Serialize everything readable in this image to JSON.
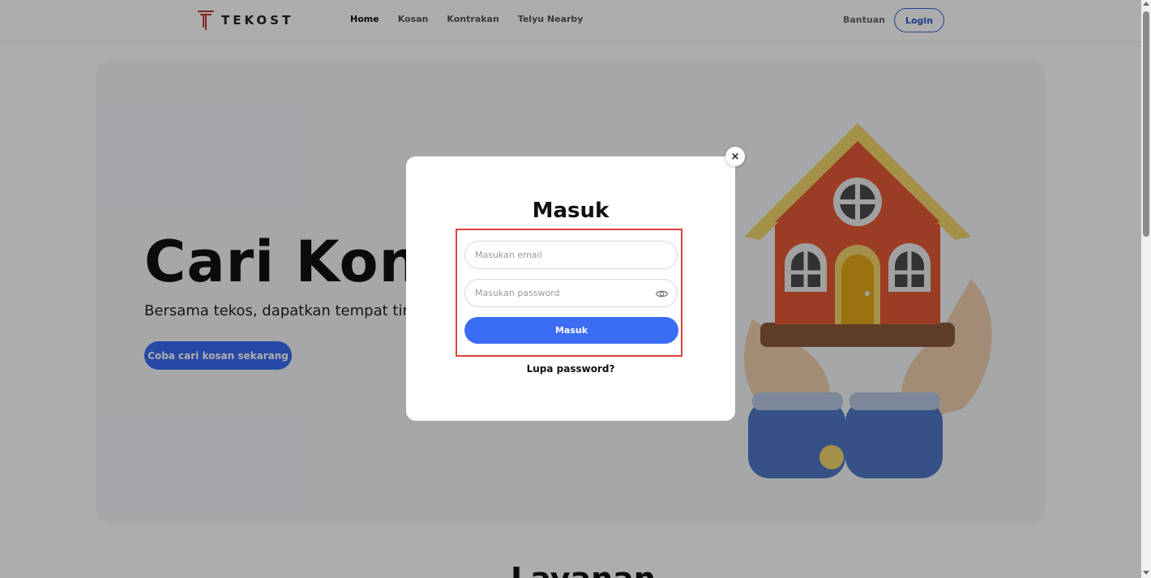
{
  "brand": {
    "name": "TEKOST",
    "accent": "#3a6cf4",
    "logo_color": "#c0392b"
  },
  "nav": {
    "links": [
      {
        "label": "Home",
        "active": true
      },
      {
        "label": "Kosan",
        "active": false
      },
      {
        "label": "Kontrakan",
        "active": false
      },
      {
        "label": "Telyu Nearby",
        "active": false
      }
    ],
    "help_label": "Bantuan",
    "login_label": "Login"
  },
  "hero": {
    "title": "Cari Kontrakan",
    "subtitle": "Bersama tekos, dapatkan tempat tinggal",
    "cta_label": "Coba cari kosan sekarang"
  },
  "section": {
    "heading": "Layanan"
  },
  "modal": {
    "close_label": "×",
    "title": "Masuk",
    "email_placeholder": "Masukan email",
    "password_placeholder": "Masukan password",
    "submit_label": "Masuk",
    "forgot_label": "Lupa password?",
    "highlight_color": "#e0413a"
  },
  "icons": {
    "eye": "eye-icon",
    "close": "close-icon",
    "logo": "logo-icon"
  }
}
